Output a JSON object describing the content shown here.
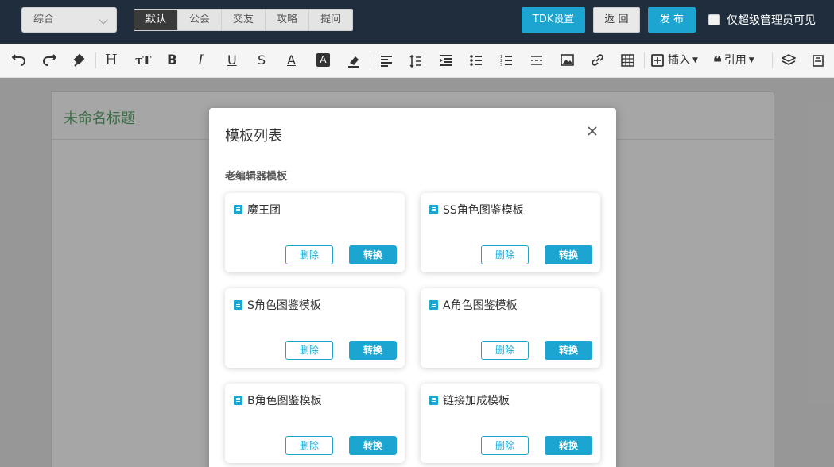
{
  "topbar": {
    "category_select": "综合",
    "tabs": [
      "默认",
      "公会",
      "交友",
      "攻略",
      "提问"
    ],
    "tdk_button": "TDK设置",
    "back_button": "返 回",
    "publish_button": "发 布",
    "admin_only_label": "仅超级管理员可见"
  },
  "toolbar": {
    "insert_label": "插入",
    "quote_label": "引用"
  },
  "editor": {
    "title_placeholder": "未命名标题"
  },
  "modal": {
    "title": "模板列表",
    "section_title": "老编辑器模板",
    "delete_label": "删除",
    "convert_label": "转换",
    "templates": [
      {
        "name": "魔王团"
      },
      {
        "name": "SS角色图鉴模板"
      },
      {
        "name": "S角色图鉴模板"
      },
      {
        "name": "A角色图鉴模板"
      },
      {
        "name": "B角色图鉴模板"
      },
      {
        "name": "链接加成模板"
      }
    ]
  },
  "colors": {
    "accent": "#1ba5d0",
    "topbar_bg": "#1f2d3d",
    "title_green": "#5aa86a"
  }
}
